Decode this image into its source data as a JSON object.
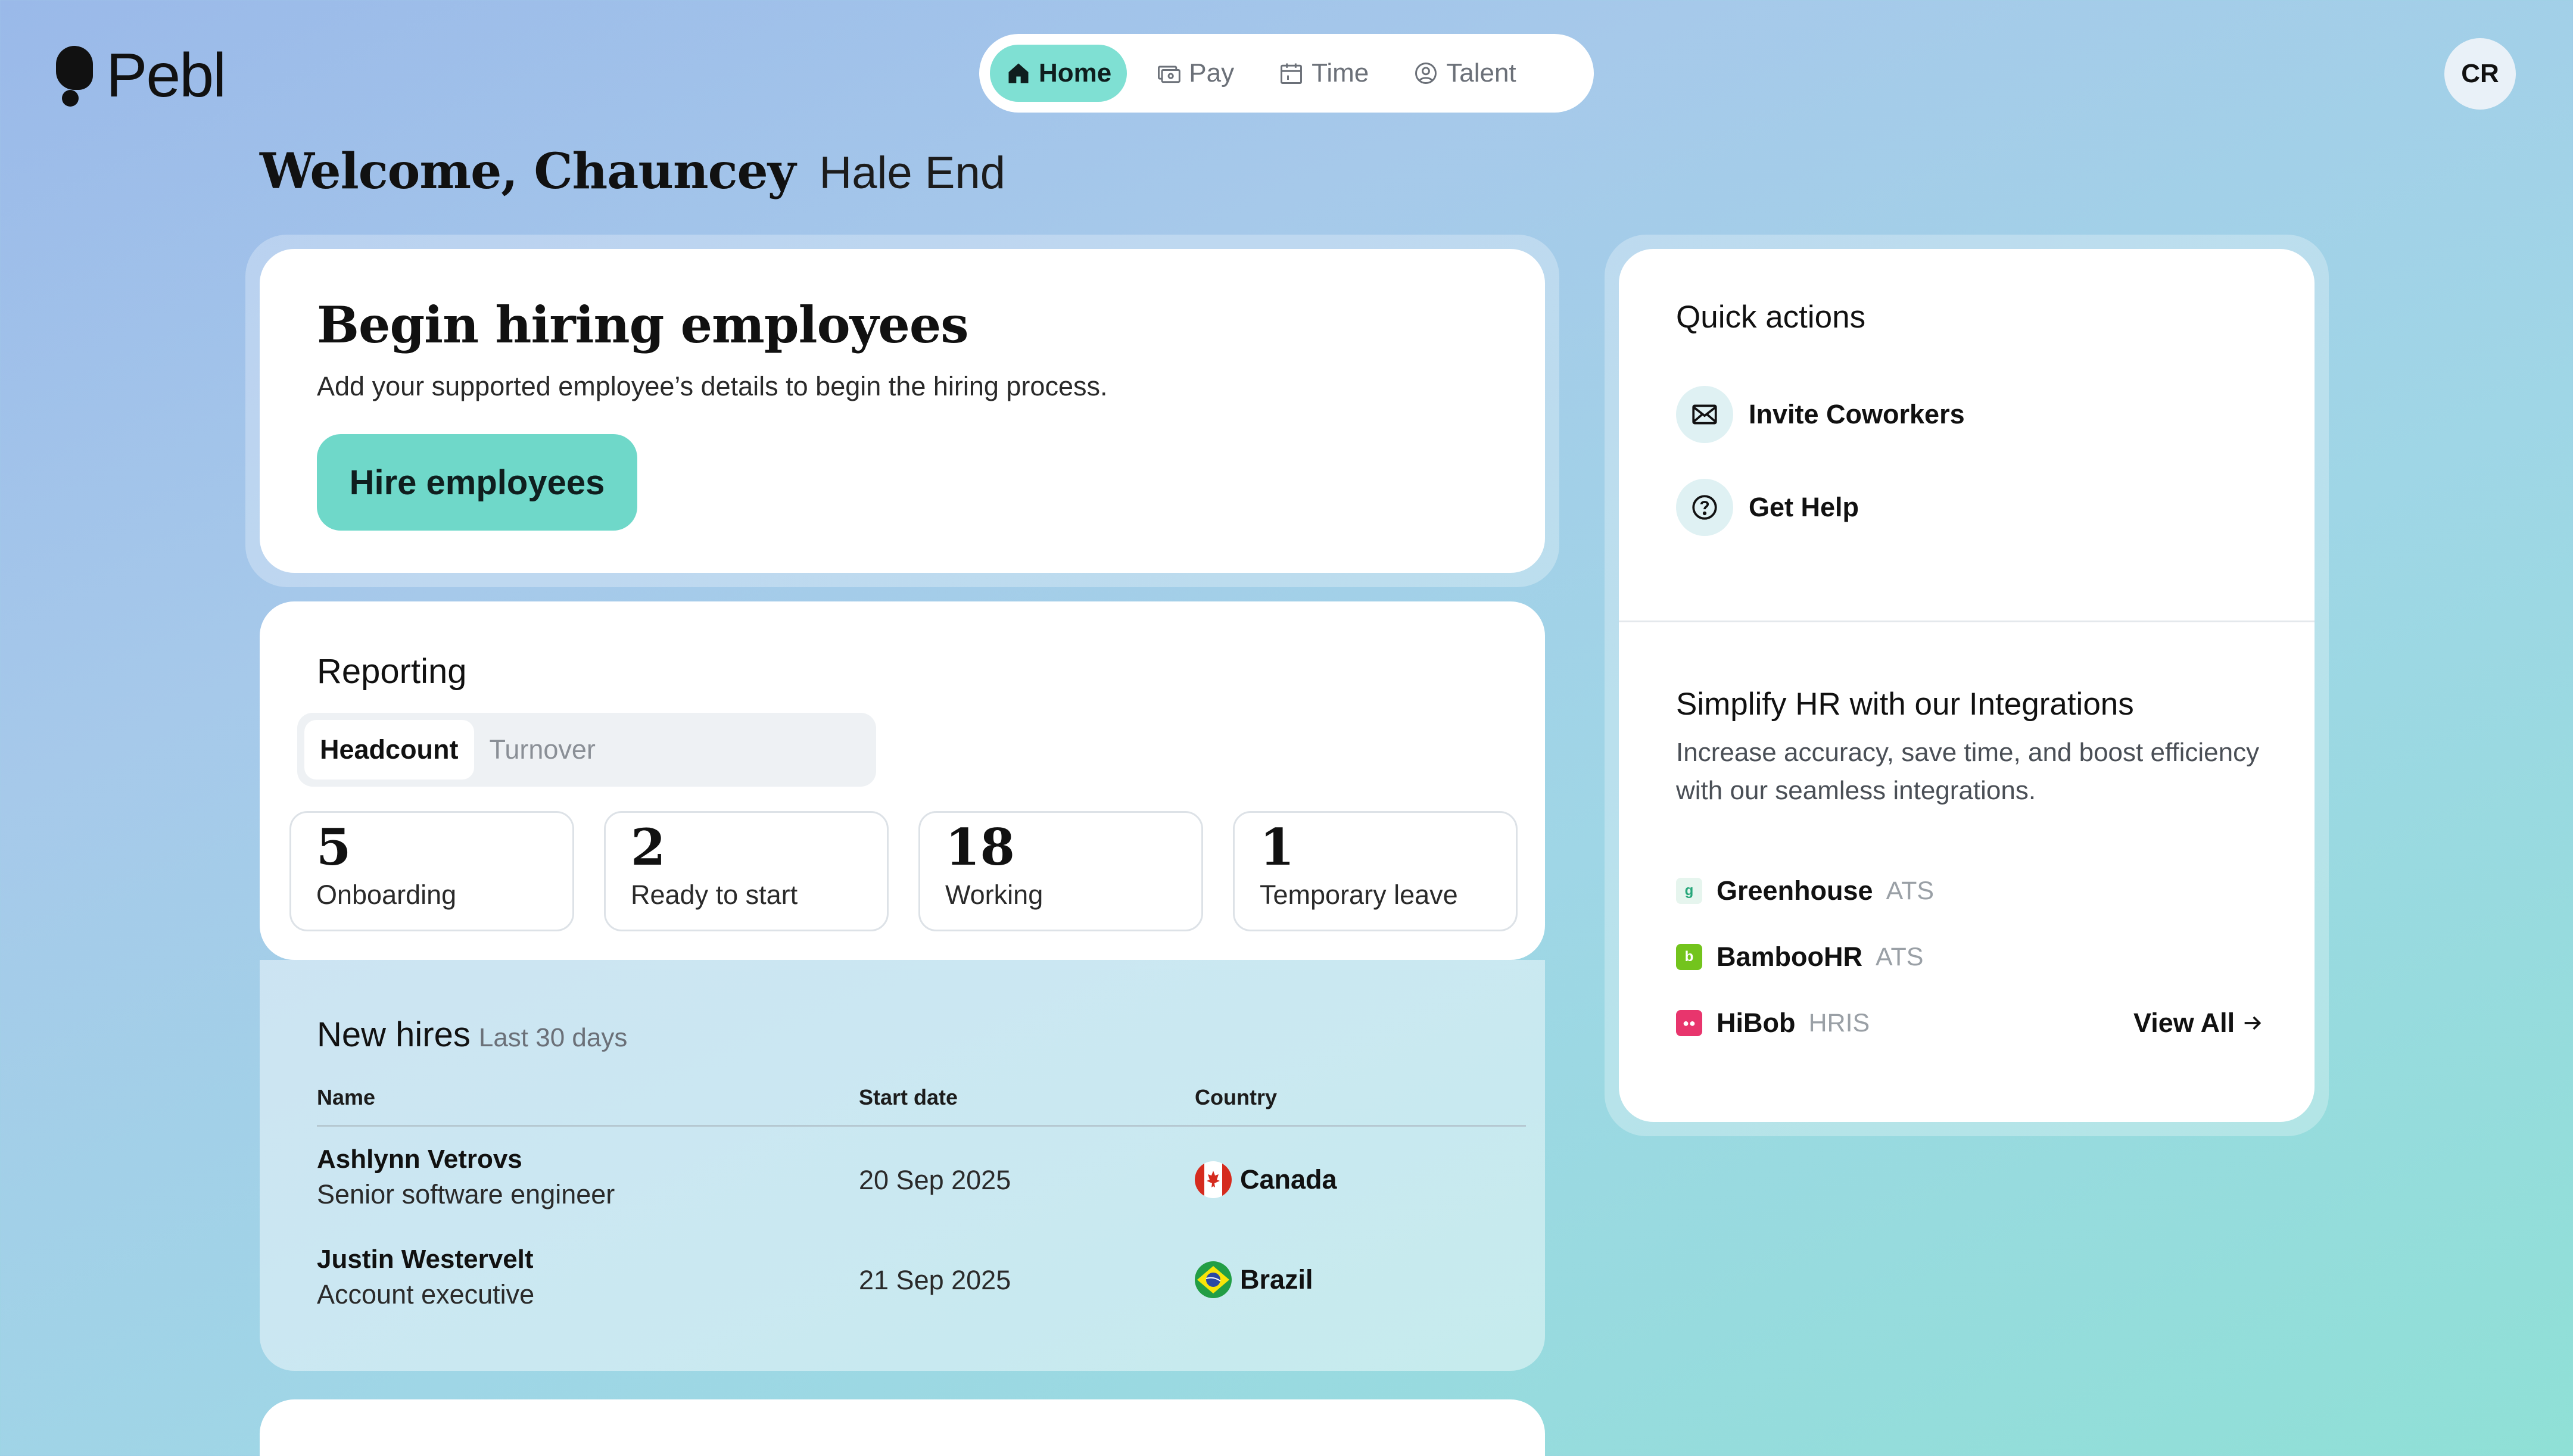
{
  "brand": {
    "name": "Pebl",
    "accent": "#7fe0d3"
  },
  "nav": {
    "items": [
      {
        "label": "Home",
        "icon": "home-icon",
        "active": true
      },
      {
        "label": "Pay",
        "icon": "pay-icon",
        "active": false
      },
      {
        "label": "Time",
        "icon": "calendar-icon",
        "active": false
      },
      {
        "label": "Talent",
        "icon": "person-icon",
        "active": false
      }
    ]
  },
  "user": {
    "initials": "CR"
  },
  "welcome": {
    "greeting": "Welcome, Chauncey",
    "org": "Hale End"
  },
  "hire": {
    "title": "Begin hiring employees",
    "description": "Add your supported employee’s details to begin the hiring process.",
    "button": "Hire employees"
  },
  "reporting": {
    "title": "Reporting",
    "tabs": [
      {
        "label": "Headcount",
        "active": true
      },
      {
        "label": "Turnover",
        "active": false
      }
    ],
    "stats": [
      {
        "value": "5",
        "label": "Onboarding"
      },
      {
        "value": "2",
        "label": "Ready to start"
      },
      {
        "value": "18",
        "label": "Working"
      },
      {
        "value": "1",
        "label": "Temporary leave"
      }
    ]
  },
  "new_hires": {
    "title": "New hires",
    "subtitle": "Last 30 days",
    "columns": [
      "Name",
      "Start date",
      "Country"
    ],
    "rows": [
      {
        "name": "Ashlynn Vetrovs",
        "role": "Senior software engineer",
        "start": "20 Sep 2025",
        "country": "Canada",
        "flag": "canada-flag-icon"
      },
      {
        "name": "Justin Westervelt",
        "role": "Account executive",
        "start": "21 Sep 2025",
        "country": "Brazil",
        "flag": "brazil-flag-icon"
      }
    ]
  },
  "quick_actions": {
    "title": "Quick actions",
    "items": [
      {
        "label": "Invite Coworkers",
        "icon": "mail-icon"
      },
      {
        "label": "Get Help",
        "icon": "help-icon"
      }
    ]
  },
  "integrations": {
    "title": "Simplify HR with our Integrations",
    "description": "Increase accuracy, save time, and boost efficiency with our seamless integrations.",
    "items": [
      {
        "name": "Greenhouse",
        "type": "ATS",
        "color": "#27a77a"
      },
      {
        "name": "BambooHR",
        "type": "ATS",
        "color": "#73c41d"
      },
      {
        "name": "HiBob",
        "type": "HRIS",
        "color": "#e8356d"
      }
    ],
    "view_all": "View All"
  }
}
